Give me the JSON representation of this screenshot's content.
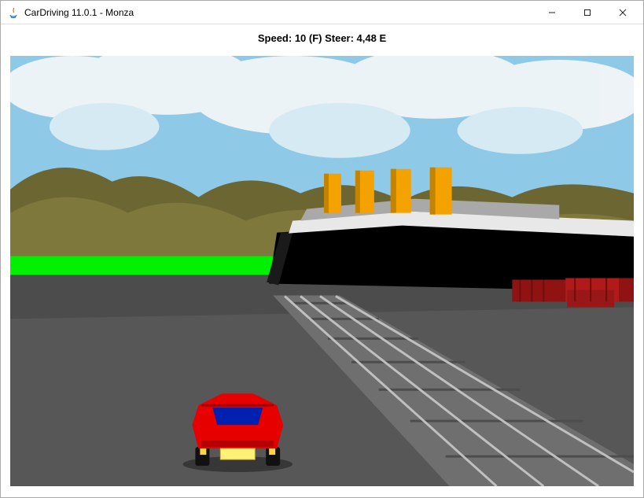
{
  "window": {
    "title": "CarDriving 11.0.1 - Monza"
  },
  "hud": {
    "text": "Speed: 10 (F)  Steer: 4,48 E"
  },
  "colors": {
    "sky": "#8ec9e8",
    "cloud": "#f0f5f8",
    "hill_dark": "#6c6732",
    "hill_light": "#837b3e",
    "grass": "#00f000",
    "asphalt_far": "#4a4a4a",
    "asphalt_near": "#575757",
    "ship_hull": "#000000",
    "ship_deck_light": "#e8e8e8",
    "ship_deck_shadow": "#a9a9a9",
    "funnel": "#f3a200",
    "container": "#b11a1a",
    "car_body": "#e60000",
    "car_window": "#0020b0",
    "car_plate": "#fff176",
    "rail": "#8a8a8a"
  },
  "scene": {
    "speed": 10,
    "speed_mode": "F",
    "steer": 4.48,
    "steer_mode": "E",
    "track": "Monza",
    "objects": [
      "sky",
      "hills",
      "grass-strip",
      "asphalt",
      "railway",
      "ship",
      "containers",
      "player-car"
    ]
  }
}
